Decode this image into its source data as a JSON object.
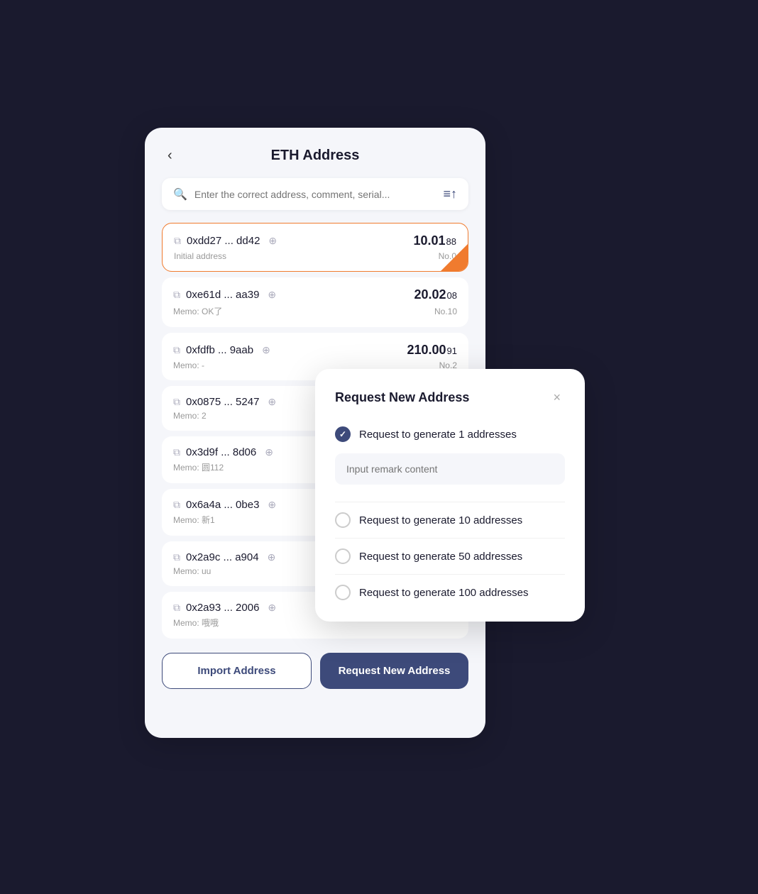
{
  "header": {
    "title": "ETH Address",
    "back_label": "‹"
  },
  "search": {
    "placeholder": "Enter the correct address, comment, serial..."
  },
  "filter_icon": "≡↑",
  "addresses": [
    {
      "address": "0xdd27 ... dd42",
      "memo": "Initial address",
      "amount_main": "10.01",
      "amount_decimal": "88",
      "no": "No.0",
      "active": true
    },
    {
      "address": "0xe61d ... aa39",
      "memo": "Memo: OK了",
      "amount_main": "20.02",
      "amount_decimal": "08",
      "no": "No.10",
      "active": false
    },
    {
      "address": "0xfdfb ... 9aab",
      "memo": "Memo: -",
      "amount_main": "210.00",
      "amount_decimal": "91",
      "no": "No.2",
      "active": false
    },
    {
      "address": "0x0875 ... 5247",
      "memo": "Memo: 2",
      "amount_main": "",
      "amount_decimal": "",
      "no": "",
      "active": false
    },
    {
      "address": "0x3d9f ... 8d06",
      "memo": "Memo: 圆112",
      "amount_main": "",
      "amount_decimal": "",
      "no": "",
      "active": false
    },
    {
      "address": "0x6a4a ... 0be3",
      "memo": "Memo: 新1",
      "amount_main": "",
      "amount_decimal": "",
      "no": "",
      "active": false
    },
    {
      "address": "0x2a9c ... a904",
      "memo": "Memo: uu",
      "amount_main": "",
      "amount_decimal": "",
      "no": "",
      "active": false
    },
    {
      "address": "0x2a93 ... 2006",
      "memo": "Memo: 哦哦",
      "amount_main": "",
      "amount_decimal": "",
      "no": "",
      "active": false
    }
  ],
  "buttons": {
    "import": "Import Address",
    "request": "Request New Address"
  },
  "modal": {
    "title": "Request New Address",
    "close_label": "×",
    "remark_placeholder": "Input remark content",
    "options": [
      {
        "label": "Request to generate 1 addresses",
        "checked": true
      },
      {
        "label": "Request to generate 10 addresses",
        "checked": false
      },
      {
        "label": "Request to generate 50 addresses",
        "checked": false
      },
      {
        "label": "Request to generate 100 addresses",
        "checked": false
      }
    ]
  }
}
